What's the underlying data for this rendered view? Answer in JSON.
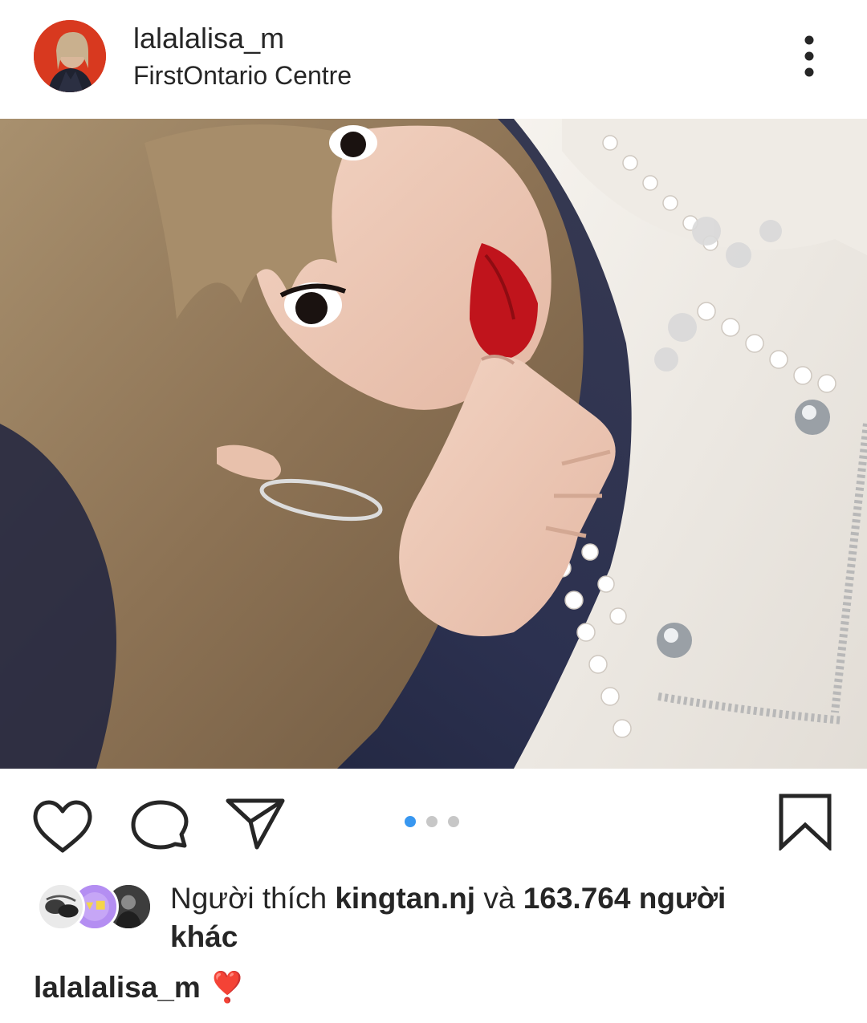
{
  "post": {
    "username": "lalalalisa_m",
    "location": "FirstOntario Centre"
  },
  "carousel": {
    "total_images": 3,
    "active_index": 0
  },
  "likes": {
    "prefix": "Người thích",
    "first_liker": "kingtan.nj",
    "joiner": "và",
    "others_count": "163.764 người",
    "others_suffix": "khác"
  },
  "caption": {
    "username": "lalalalisa_m",
    "text": "❣️"
  },
  "colors": {
    "carousel_active": "#3897f0",
    "carousel_inactive": "#c7c7c7",
    "text": "#262626"
  },
  "icons": {
    "more": "vertical-ellipsis-icon",
    "like": "heart-outline-icon",
    "comment": "speech-bubble-icon",
    "share": "paper-plane-icon",
    "save": "bookmark-icon"
  }
}
